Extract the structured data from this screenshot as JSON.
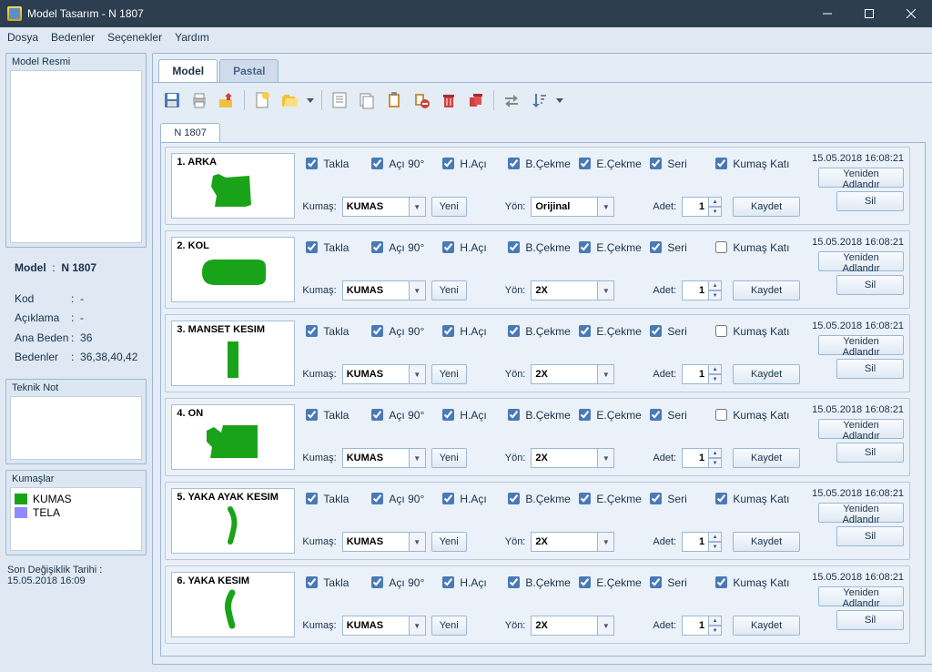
{
  "window": {
    "title": "Model Tasarım - N 1807"
  },
  "menu": [
    "Dosya",
    "Bedenler",
    "Seçenekler",
    "Yardım"
  ],
  "side": {
    "modelResmi": "Model Resmi",
    "modelLabel": "Model",
    "modelValue": "N 1807",
    "kodLabel": "Kod",
    "kodValue": "-",
    "aciklamaLabel": "Açıklama",
    "aciklamaValue": "-",
    "anaBedenLabel": "Ana Beden",
    "anaBedenValue": "36",
    "bedenlerLabel": "Bedenler",
    "bedenlerValue": "36,38,40,42",
    "teknikNot": "Teknik Not",
    "kumaslar": "Kumaşlar",
    "kumasList": [
      {
        "name": "KUMAS",
        "color": "#19a319"
      },
      {
        "name": "TELA",
        "color": "#8c8cff"
      }
    ],
    "footer": "Son Değişiklik Tarihi   :  15.05.2018 16:09"
  },
  "tabs": {
    "model": "Model",
    "pastal": "Pastal"
  },
  "subtab": "N 1807",
  "labels": {
    "takla": "Takla",
    "aci90": "Açı 90°",
    "haci": "H.Açı",
    "bcekme": "B.Çekme",
    "ecekme": "E.Çekme",
    "seri": "Seri",
    "kumasKati": "Kumaş Katı",
    "kumas": "Kumaş:",
    "yeni": "Yeni",
    "yon": "Yön:",
    "adet": "Adet:",
    "kaydet": "Kaydet",
    "sil": "Sil",
    "yeniden": "Yeniden Adlandır"
  },
  "pieces": [
    {
      "n": "1",
      "name": "ARKA",
      "ts": "15.05.2018 16:08:21",
      "kumas": "KUMAS",
      "yon": "Orijinal",
      "adet": "1",
      "kk": true,
      "shape": "arka"
    },
    {
      "n": "2",
      "name": "KOL",
      "ts": "15.05.2018 16:08:21",
      "kumas": "KUMAS",
      "yon": "2X",
      "adet": "1",
      "kk": false,
      "shape": "kol"
    },
    {
      "n": "3",
      "name": "MANSET KESIM",
      "ts": "15.05.2018 16:08:21",
      "kumas": "KUMAS",
      "yon": "2X",
      "adet": "1",
      "kk": false,
      "shape": "manset"
    },
    {
      "n": "4",
      "name": "ON",
      "ts": "15.05.2018 16:08:21",
      "kumas": "KUMAS",
      "yon": "2X",
      "adet": "1",
      "kk": false,
      "shape": "on"
    },
    {
      "n": "5",
      "name": "YAKA AYAK KESIM",
      "ts": "15.05.2018 16:08:21",
      "kumas": "KUMAS",
      "yon": "2X",
      "adet": "1",
      "kk": true,
      "shape": "yaka1"
    },
    {
      "n": "6",
      "name": "YAKA KESIM",
      "ts": "15.05.2018 16:08:21",
      "kumas": "KUMAS",
      "yon": "2X",
      "adet": "1",
      "kk": true,
      "shape": "yaka2"
    }
  ]
}
